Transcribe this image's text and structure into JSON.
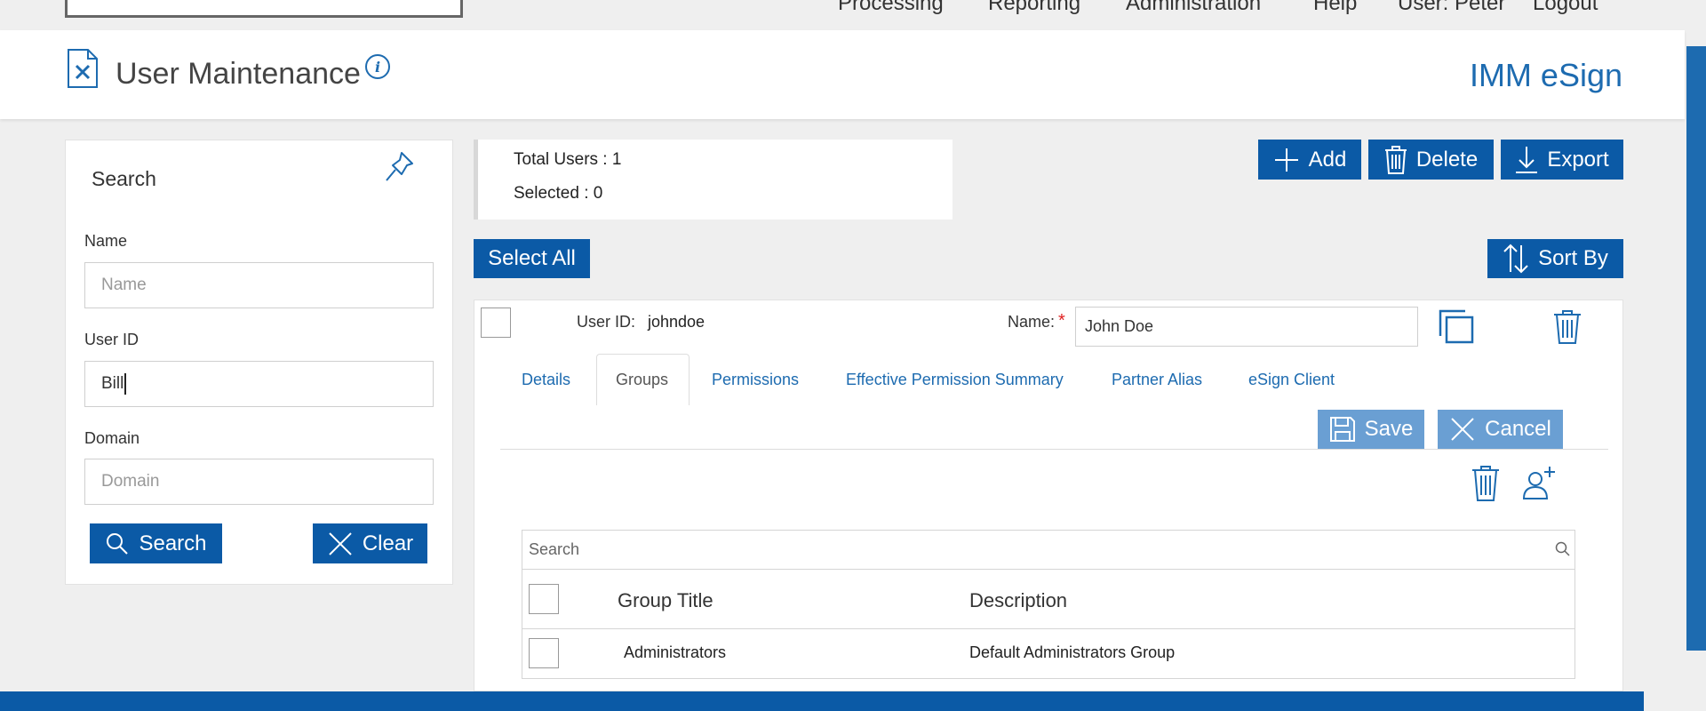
{
  "topnav": {
    "items": [
      "Processing",
      "Reporting",
      "Administration",
      "Help",
      "User: Peter",
      "Logout"
    ]
  },
  "header": {
    "title": "User Maintenance",
    "brand": "IMM eSign"
  },
  "search_panel": {
    "title": "Search",
    "name_label": "Name",
    "name_placeholder": "Name",
    "userid_label": "User ID",
    "userid_value": "Bill",
    "domain_label": "Domain",
    "domain_placeholder": "Domain",
    "search_button": "Search",
    "clear_button": "Clear"
  },
  "summary": {
    "total_users": "Total Users : 1",
    "selected": "Selected : 0"
  },
  "toolbar": {
    "add": "Add",
    "delete": "Delete",
    "export": "Export",
    "select_all": "Select All",
    "sort_by": "Sort By"
  },
  "user_card": {
    "userid_label": "User ID:",
    "userid_value": "johndoe",
    "name_label": "Name:",
    "required_mark": "*",
    "name_value": "John Doe",
    "tabs": [
      "Details",
      "Groups",
      "Permissions",
      "Effective Permission Summary",
      "Partner Alias",
      "eSign Client"
    ],
    "active_tab": "Groups",
    "save": "Save",
    "cancel": "Cancel"
  },
  "groups_table": {
    "search_placeholder": "Search",
    "columns": [
      "Group Title",
      "Description"
    ],
    "rows": [
      {
        "title": "Administrators",
        "description": "Default Administrators Group"
      }
    ]
  },
  "colors": {
    "primary": "#0b5aa6",
    "primary_light": "#6a9fd3",
    "link": "#1d6bb0",
    "required": "#e02020"
  }
}
